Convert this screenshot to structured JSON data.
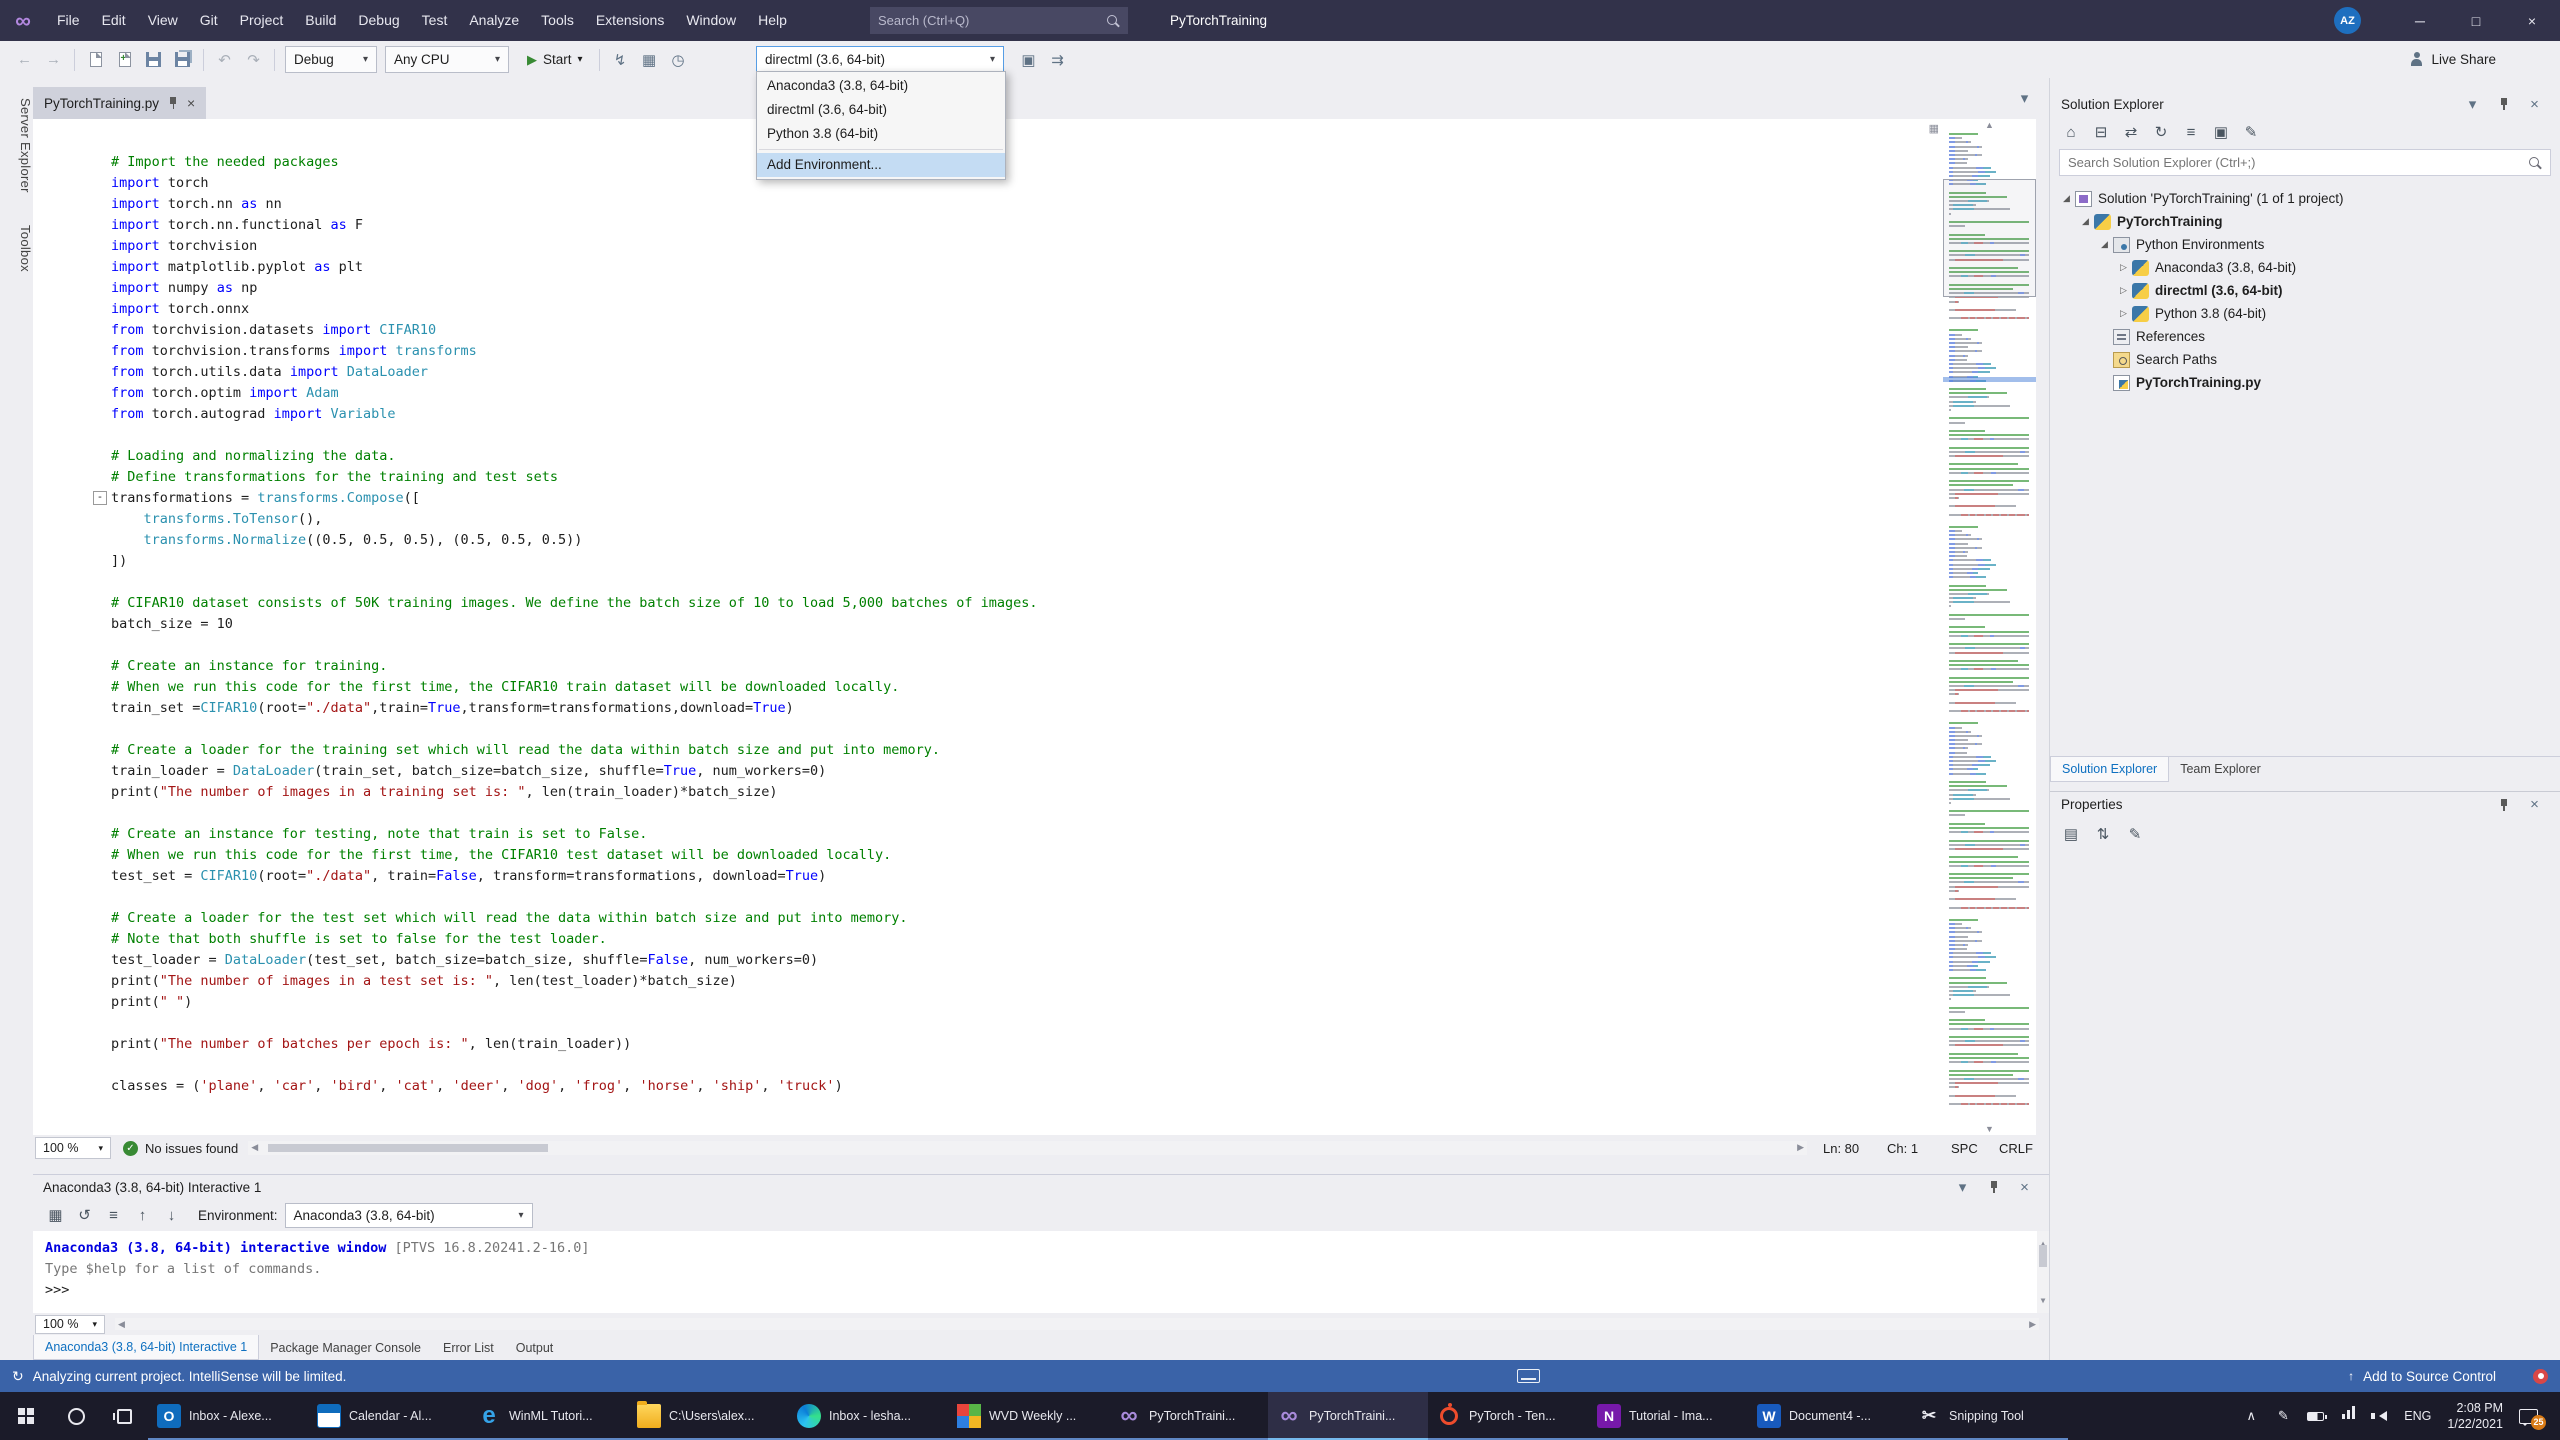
{
  "titlebar": {
    "menus": [
      "File",
      "Edit",
      "View",
      "Git",
      "Project",
      "Build",
      "Debug",
      "Test",
      "Analyze",
      "Tools",
      "Extensions",
      "Window",
      "Help"
    ],
    "search_placeholder": "Search (Ctrl+Q)",
    "app_title": "PyTorchTraining",
    "avatar": "AZ",
    "window_controls": [
      "minimize",
      "maximize",
      "close"
    ]
  },
  "toolbar": {
    "nav_icons": [
      "back",
      "forward"
    ],
    "file_icons": [
      "new-file",
      "add-item",
      "save",
      "save-all"
    ],
    "edit_icons": [
      "undo",
      "redo"
    ],
    "debug_config": "Debug",
    "platform": "Any CPU",
    "start_label": "Start",
    "run_icons": [
      "attach",
      "live-grid",
      "diagnostics"
    ],
    "env_value": "directml (3.6, 64-bit)",
    "post_env_icons": [
      "interactive-window",
      "send-to-interactive"
    ],
    "live_share_label": "Live Share"
  },
  "env_dropdown": {
    "items": [
      {
        "label": "Anaconda3 (3.8, 64-bit)"
      },
      {
        "label": "directml (3.6, 64-bit)"
      },
      {
        "label": "Python 3.8 (64-bit)"
      },
      {
        "label": "Add Environment...",
        "highlighted": true,
        "separator_before": true
      }
    ]
  },
  "left_rail": [
    "Server Explorer",
    "Toolbox"
  ],
  "editor": {
    "tab": "PyTorchTraining.py",
    "tabstrip_icons": [
      "chevron-down"
    ],
    "zoom": "100 %",
    "health": "No issues found",
    "status": {
      "line": "Ln: 80",
      "col": "Ch: 1",
      "mode": "SPC",
      "eol": "CRLF"
    },
    "fold_marker": "-",
    "code": [
      [
        [
          "c",
          "# Import the needed packages"
        ]
      ],
      [
        [
          "k",
          "import"
        ],
        [
          "p",
          " torch"
        ]
      ],
      [
        [
          "k",
          "import"
        ],
        [
          "p",
          " torch.nn "
        ],
        [
          "k",
          "as"
        ],
        [
          "p",
          " nn"
        ]
      ],
      [
        [
          "k",
          "import"
        ],
        [
          "p",
          " torch.nn.functional "
        ],
        [
          "k",
          "as"
        ],
        [
          "p",
          " F"
        ]
      ],
      [
        [
          "k",
          "import"
        ],
        [
          "p",
          " torchvision"
        ]
      ],
      [
        [
          "k",
          "import"
        ],
        [
          "p",
          " matplotlib.pyplot "
        ],
        [
          "k",
          "as"
        ],
        [
          "p",
          " plt"
        ]
      ],
      [
        [
          "k",
          "import"
        ],
        [
          "p",
          " numpy "
        ],
        [
          "k",
          "as"
        ],
        [
          "p",
          " np"
        ]
      ],
      [
        [
          "k",
          "import"
        ],
        [
          "p",
          " torch.onnx"
        ]
      ],
      [
        [
          "k",
          "from"
        ],
        [
          "p",
          " torchvision.datasets "
        ],
        [
          "k",
          "import"
        ],
        [
          "t",
          " CIFAR10"
        ]
      ],
      [
        [
          "k",
          "from"
        ],
        [
          "p",
          " torchvision.transforms "
        ],
        [
          "k",
          "import"
        ],
        [
          "t",
          " transforms"
        ]
      ],
      [
        [
          "k",
          "from"
        ],
        [
          "p",
          " torch.utils.data "
        ],
        [
          "k",
          "import"
        ],
        [
          "t",
          " DataLoader"
        ]
      ],
      [
        [
          "k",
          "from"
        ],
        [
          "p",
          " torch.optim "
        ],
        [
          "k",
          "import"
        ],
        [
          "t",
          " Adam"
        ]
      ],
      [
        [
          "k",
          "from"
        ],
        [
          "p",
          " torch.autograd "
        ],
        [
          "k",
          "import"
        ],
        [
          "t",
          " Variable"
        ]
      ],
      [],
      [
        [
          "c",
          "# Loading and normalizing the data."
        ]
      ],
      [
        [
          "c",
          "# Define transformations for the training and test sets"
        ]
      ],
      [
        [
          "p",
          "transformations = "
        ],
        [
          "t",
          "transforms.Compose"
        ],
        [
          "p",
          "(["
        ]
      ],
      [
        [
          "p",
          "    "
        ],
        [
          "t",
          "transforms.ToTensor"
        ],
        [
          "p",
          "(),"
        ]
      ],
      [
        [
          "p",
          "    "
        ],
        [
          "t",
          "transforms.Normalize"
        ],
        [
          "p",
          "((0.5, 0.5, 0.5), (0.5, 0.5, 0.5))"
        ]
      ],
      [
        [
          "p",
          "])"
        ]
      ],
      [],
      [
        [
          "c",
          "# CIFAR10 dataset consists of 50K training images. We define the batch size of 10 to load 5,000 batches of images."
        ]
      ],
      [
        [
          "p",
          "batch_size = 10"
        ]
      ],
      [],
      [
        [
          "c",
          "# Create an instance for training."
        ]
      ],
      [
        [
          "c",
          "# When we run this code for the first time, the CIFAR10 train dataset will be downloaded locally."
        ]
      ],
      [
        [
          "p",
          "train_set ="
        ],
        [
          "t",
          "CIFAR10"
        ],
        [
          "p",
          "(root="
        ],
        [
          "s",
          "\"./data\""
        ],
        [
          "p",
          ",train="
        ],
        [
          "k",
          "True"
        ],
        [
          "p",
          ",transform=transformations,download="
        ],
        [
          "k",
          "True"
        ],
        [
          "p",
          ")"
        ]
      ],
      [],
      [
        [
          "c",
          "# Create a loader for the training set which will read the data within batch size and put into memory."
        ]
      ],
      [
        [
          "p",
          "train_loader = "
        ],
        [
          "t",
          "DataLoader"
        ],
        [
          "p",
          "(train_set, batch_size=batch_size, shuffle="
        ],
        [
          "k",
          "True"
        ],
        [
          "p",
          ", num_workers=0)"
        ]
      ],
      [
        [
          "p",
          "print("
        ],
        [
          "s",
          "\"The number of images in a training set is: \""
        ],
        [
          "p",
          ", len(train_loader)*batch_size)"
        ]
      ],
      [],
      [
        [
          "c",
          "# Create an instance for testing, note that train is set to False."
        ]
      ],
      [
        [
          "c",
          "# When we run this code for the first time, the CIFAR10 test dataset will be downloaded locally."
        ]
      ],
      [
        [
          "p",
          "test_set = "
        ],
        [
          "t",
          "CIFAR10"
        ],
        [
          "p",
          "(root="
        ],
        [
          "s",
          "\"./data\""
        ],
        [
          "p",
          ", train="
        ],
        [
          "k",
          "False"
        ],
        [
          "p",
          ", transform=transformations, download="
        ],
        [
          "k",
          "True"
        ],
        [
          "p",
          ")"
        ]
      ],
      [],
      [
        [
          "c",
          "# Create a loader for the test set which will read the data within batch size and put into memory."
        ]
      ],
      [
        [
          "c",
          "# Note that both shuffle is set to false for the test loader."
        ]
      ],
      [
        [
          "p",
          "test_loader = "
        ],
        [
          "t",
          "DataLoader"
        ],
        [
          "p",
          "(test_set, batch_size=batch_size, shuffle="
        ],
        [
          "k",
          "False"
        ],
        [
          "p",
          ", num_workers=0)"
        ]
      ],
      [
        [
          "p",
          "print("
        ],
        [
          "s",
          "\"The number of images in a test set is: \""
        ],
        [
          "p",
          ", len(test_loader)*batch_size)"
        ]
      ],
      [
        [
          "p",
          "print("
        ],
        [
          "s",
          "\" \""
        ],
        [
          "p",
          ")"
        ]
      ],
      [],
      [
        [
          "p",
          "print("
        ],
        [
          "s",
          "\"The number of batches per epoch is: \""
        ],
        [
          "p",
          ", len(train_loader))"
        ]
      ],
      [],
      [
        [
          "p",
          "classes = ("
        ],
        [
          "s",
          "'plane'"
        ],
        [
          "p",
          ", "
        ],
        [
          "s",
          "'car'"
        ],
        [
          "p",
          ", "
        ],
        [
          "s",
          "'bird'"
        ],
        [
          "p",
          ", "
        ],
        [
          "s",
          "'cat'"
        ],
        [
          "p",
          ", "
        ],
        [
          "s",
          "'deer'"
        ],
        [
          "p",
          ", "
        ],
        [
          "s",
          "'dog'"
        ],
        [
          "p",
          ", "
        ],
        [
          "s",
          "'frog'"
        ],
        [
          "p",
          ", "
        ],
        [
          "s",
          "'horse'"
        ],
        [
          "p",
          ", "
        ],
        [
          "s",
          "'ship'"
        ],
        [
          "p",
          ", "
        ],
        [
          "s",
          "'truck'"
        ],
        [
          "p",
          ")"
        ]
      ]
    ]
  },
  "interactive": {
    "title": "Anaconda3 (3.8, 64-bit) Interactive 1",
    "title_icons": [
      "chevron-down",
      "pin",
      "close"
    ],
    "toolbar_icons": [
      "environment-grid",
      "reset-repl",
      "history-list",
      "history-previous",
      "history-next"
    ],
    "env_label": "Environment:",
    "env_value": "Anaconda3 (3.8, 64-bit)",
    "lines": [
      [
        [
          "b",
          "Anaconda3 (3.8, 64-bit) interactive window "
        ],
        [
          "g",
          "[PTVS 16.8.20241.2-16.0]"
        ]
      ],
      [
        [
          "g",
          "Type $help for a list of commands."
        ]
      ],
      [
        [
          "p",
          ">>> "
        ]
      ]
    ],
    "zoom": "100 %",
    "tabs": [
      "Anaconda3 (3.8, 64-bit) Interactive 1",
      "Package Manager Console",
      "Error List",
      "Output"
    ],
    "active_tab_index": 0
  },
  "solution_explorer": {
    "title": "Solution Explorer",
    "title_icons": [
      "chevron-down",
      "pin",
      "close"
    ],
    "toolbar_icons": [
      "home",
      "collapse-all",
      "sync-with-active-document",
      "refresh",
      "nest-files",
      "show-all-files",
      "properties"
    ],
    "search_placeholder": "Search Solution Explorer (Ctrl+;)",
    "tree": [
      {
        "depth": 0,
        "arrow": "exp",
        "icon": "solution",
        "label": "Solution 'PyTorchTraining' (1 of 1 project)",
        "bold": false
      },
      {
        "depth": 1,
        "arrow": "exp",
        "icon": "python-project",
        "label": "PyTorchTraining",
        "bold": true
      },
      {
        "depth": 2,
        "arrow": "exp",
        "icon": "python-environments",
        "label": "Python Environments",
        "bold": false
      },
      {
        "depth": 3,
        "arrow": "col",
        "icon": "python-environment",
        "label": "Anaconda3 (3.8, 64-bit)",
        "bold": false
      },
      {
        "depth": 3,
        "arrow": "col",
        "icon": "python-environment",
        "label": "directml (3.6, 64-bit)",
        "bold": true
      },
      {
        "depth": 3,
        "arrow": "col",
        "icon": "python-environment",
        "label": "Python 3.8 (64-bit)",
        "bold": false
      },
      {
        "depth": 2,
        "arrow": null,
        "icon": "references",
        "label": "References",
        "bold": false
      },
      {
        "depth": 2,
        "arrow": null,
        "icon": "search-paths",
        "label": "Search Paths",
        "bold": false
      },
      {
        "depth": 2,
        "arrow": null,
        "icon": "python-file",
        "label": "PyTorchTraining.py",
        "bold": true
      }
    ],
    "tabs": [
      "Solution Explorer",
      "Team Explorer"
    ],
    "active_tab_index": 0
  },
  "properties": {
    "title": "Properties",
    "title_icons": [
      "pin",
      "close"
    ],
    "toolbar_icons": [
      "categorized",
      "alphabetical",
      "property-pages"
    ]
  },
  "status_bar": {
    "message": "Analyzing current project. IntelliSense will be limited.",
    "source_control": "Add to Source Control"
  },
  "taskbar": {
    "apps": [
      {
        "icon": "outlook",
        "label": "Inbox - Alexe..."
      },
      {
        "icon": "calendar",
        "label": "Calendar - Al..."
      },
      {
        "icon": "edge",
        "label": "WinML Tutori..."
      },
      {
        "icon": "explorer",
        "label": "C:\\Users\\alex..."
      },
      {
        "icon": "edge-round",
        "label": "Inbox - lesha..."
      },
      {
        "icon": "wvd",
        "label": "WVD Weekly ..."
      },
      {
        "icon": "visual-studio",
        "label": "PyTorchTraini..."
      },
      {
        "icon": "visual-studio",
        "label": "PyTorchTraini...",
        "active": true
      },
      {
        "icon": "pytorch",
        "label": "PyTorch - Ten..."
      },
      {
        "icon": "onenote",
        "label": "Tutorial - Ima..."
      },
      {
        "icon": "word",
        "label": "Document4 -..."
      },
      {
        "icon": "snipping",
        "label": "Snipping Tool"
      }
    ],
    "system_icons": [
      "chevron-up",
      "pen",
      "battery",
      "network",
      "volume"
    ],
    "tray": {
      "lang": "ENG",
      "time": "2:08 PM",
      "date": "1/22/2021",
      "badge": "25"
    }
  }
}
